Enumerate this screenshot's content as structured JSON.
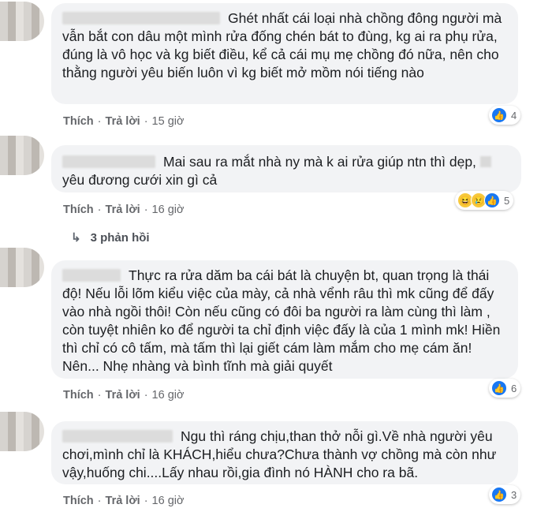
{
  "comments": [
    {
      "text": "Ghét nhất cái loại nhà chồng đông người mà vẫn bắt con dâu một mình rửa đống chén bát to đùng, kg ai ra phụ rửa, đúng là vô học và kg biết điều, kể cả cái mụ mẹ chồng đó nữa, nên cho thằng người yêu biến luôn vì kg biết mở mồm nói tiếng nào",
      "like_label": "Thích",
      "reply_label": "Trả lời",
      "time": "15 giờ",
      "reaction_count": "4",
      "reaction_icons": [
        "like-icon"
      ]
    },
    {
      "text": "Mai sau ra mắt nhà ny mà k ai rửa giúp ntn thì dẹp,",
      "text2": "yêu đương cưới xin gì cả",
      "like_label": "Thích",
      "reply_label": "Trả lời",
      "time": "16 giờ",
      "reaction_count": "5",
      "reaction_icons": [
        "haha-icon",
        "sad-icon",
        "like-icon"
      ]
    },
    {
      "text": "Thực ra rửa dăm ba cái bát là chuyện bt, quan trọng là thái độ! Nếu lỗi lõm kiểu việc của mày, cả nhà vểnh râu thì mk cũng để đấy vào nhà ngồi thôi! Còn nếu cũng có đôi ba người ra làm cùng thì làm , còn tuyệt nhiên ko để người ta chỉ định việc đấy là của 1 mình mk! Hiền thì chỉ có cô tấm, mà tấm thì lại giết cám làm mắm cho mẹ cám ăn! Nên... Nhẹ nhàng và bình tĩnh mà giải quyết",
      "like_label": "Thích",
      "reply_label": "Trả lời",
      "time": "16 giờ",
      "reaction_count": "6",
      "reaction_icons": [
        "like-icon"
      ]
    },
    {
      "text": "Ngu thì ráng chịu,than thở nỗi gì.Về nhà người yêu chơi,mình chỉ là KHÁCH,hiểu chưa?Chưa thành vợ chồng mà còn như vậy,huống chi....Lấy nhau rồi,gia đình nó HÀNH cho ra bã.",
      "like_label": "Thích",
      "reply_label": "Trả lời",
      "time": "16 giờ",
      "reaction_count": "3",
      "reaction_icons": [
        "like-icon"
      ]
    }
  ],
  "replies_label": "3 phản hồi",
  "colors": {
    "like": "#1877f2",
    "bubble": "#f2f3f5",
    "meta": "#65676b"
  }
}
